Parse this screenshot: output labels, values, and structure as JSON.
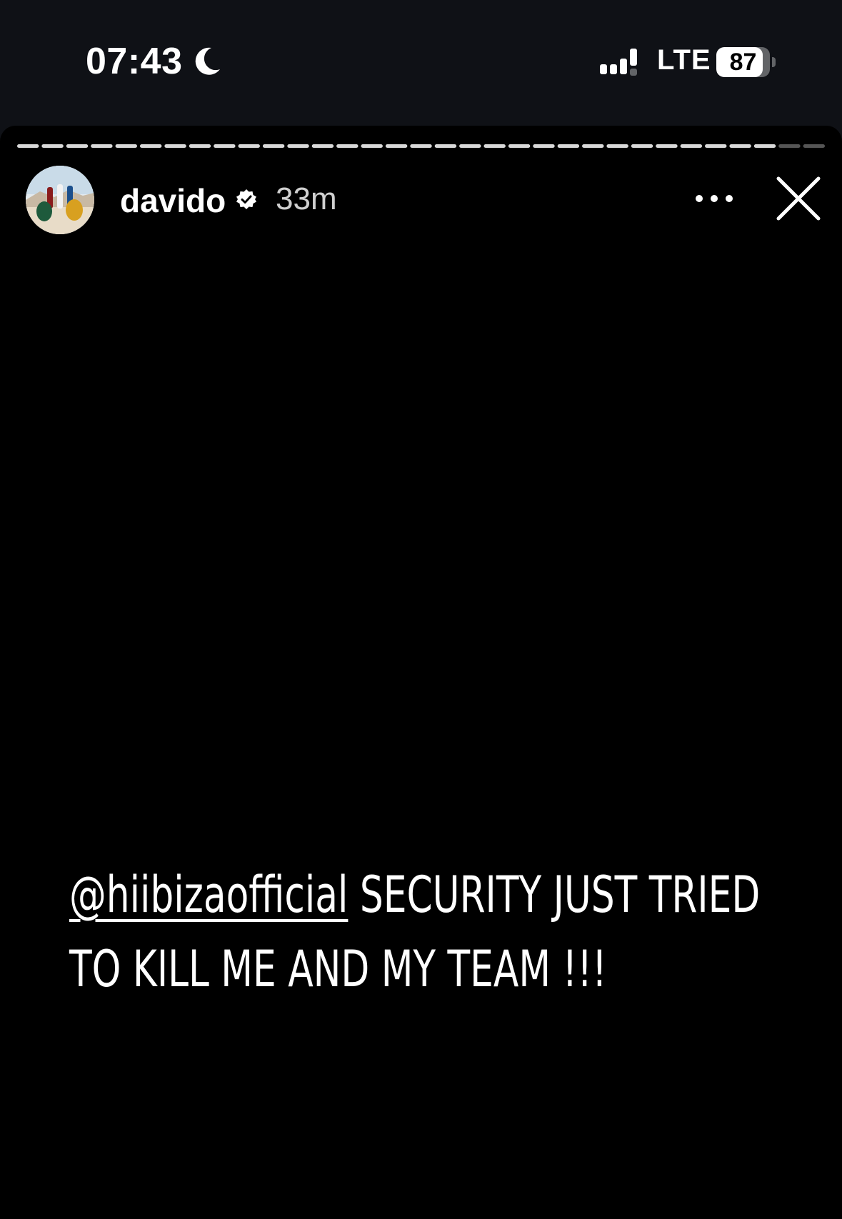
{
  "status_bar": {
    "time": "07:43",
    "network": "LTE",
    "battery_level": "87",
    "battery_fraction": 0.87,
    "focus_icon": "moon-icon",
    "signal_icon": "signal-bars-icon"
  },
  "story": {
    "segment_count": 33,
    "current_segment": 31,
    "author": {
      "username": "davido",
      "verified": true,
      "time_ago": "33m",
      "avatar_icon": "profile-avatar"
    },
    "more_icon": "more-options-icon",
    "close_icon": "close-icon",
    "caption": {
      "mention": "@hiibizaofficial",
      "line1_rest": " SECURITY JUST TRIED",
      "line2": "TO KILL ME AND MY TEAM !!!"
    }
  },
  "colors": {
    "status_background": "#0f1116",
    "story_background": "#000000",
    "text": "#ffffff",
    "segment_seen": "#d9d9d9",
    "segment_unseen": "#555555"
  }
}
